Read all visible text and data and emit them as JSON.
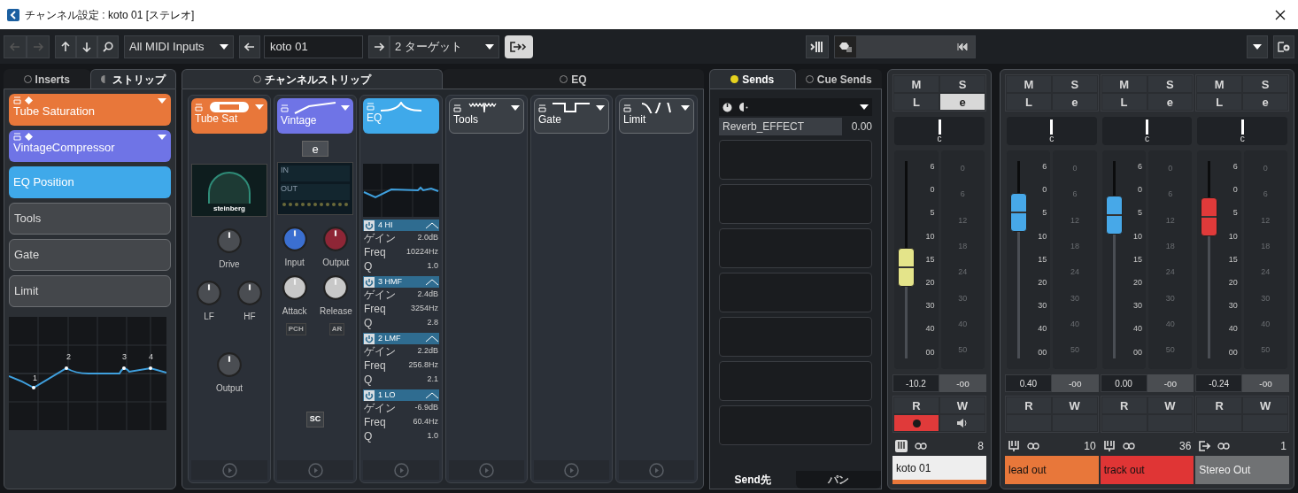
{
  "window": {
    "title": "チャンネル設定 : koto 01 [ステレオ]"
  },
  "toolbar": {
    "midi_input": "All MIDI Inputs",
    "channel_name": "koto 01",
    "target": "2 ターゲット"
  },
  "strip_editor": {
    "tabs": [
      {
        "label": "Inserts",
        "selected": false
      },
      {
        "label": "ストリップ",
        "selected": true
      }
    ],
    "slots": [
      {
        "kind": "plugin",
        "name": "Tube Saturation",
        "color": "#e8773a"
      },
      {
        "kind": "plugin",
        "name": "VintageCompressor",
        "color": "#6f74e6"
      },
      {
        "kind": "marker",
        "name": "EQ Position",
        "color": "#3fa9ea"
      },
      {
        "kind": "module",
        "name": "Tools"
      },
      {
        "kind": "module",
        "name": "Gate"
      },
      {
        "kind": "module",
        "name": "Limit"
      }
    ],
    "eq_points": [
      "1",
      "2",
      "3",
      "4"
    ]
  },
  "channel_strip": {
    "tabs": [
      {
        "label": "チャンネルストリップ",
        "selected": true
      },
      {
        "label": "EQ",
        "selected": false
      }
    ],
    "modules": [
      {
        "kind": "tube",
        "name": "Tube Sat",
        "color": "#e8773a",
        "display": "steinberg",
        "knobs": [
          {
            "label": "Drive",
            "color": "#4a4d52"
          },
          {
            "label": "LF",
            "color": "#4a4d52"
          },
          {
            "label": "HF",
            "color": "#4a4d52"
          },
          {
            "label": "Output",
            "color": "#4a4d52"
          }
        ]
      },
      {
        "kind": "compressor",
        "name": "Vintage",
        "color": "#6f74e6",
        "button": "e",
        "display": [
          "IN",
          "OUT"
        ],
        "knobs": [
          {
            "label": "Input",
            "color": "#3b6fd0"
          },
          {
            "label": "Output",
            "color": "#8e2636"
          },
          {
            "label": "Attack",
            "color": "#c8c8c8"
          },
          {
            "label": "Release",
            "color": "#c8c8c8"
          }
        ],
        "switches": [
          {
            "label": "PCH",
            "on": false
          },
          {
            "label": "AR",
            "on": false
          }
        ],
        "sidechain": "SC"
      },
      {
        "kind": "eq",
        "name": "EQ",
        "color": "#3fa9ea",
        "bands": [
          {
            "name": "4 HI",
            "on": true,
            "params": [
              {
                "label": "ゲイン",
                "value": "2.0dB"
              },
              {
                "label": "Freq",
                "value": "10224Hz"
              },
              {
                "label": "Q",
                "value": "1.0"
              }
            ]
          },
          {
            "name": "3 HMF",
            "on": true,
            "params": [
              {
                "label": "ゲイン",
                "value": "2.4dB"
              },
              {
                "label": "Freq",
                "value": "3254Hz"
              },
              {
                "label": "Q",
                "value": "2.8"
              }
            ]
          },
          {
            "name": "2 LMF",
            "on": true,
            "params": [
              {
                "label": "ゲイン",
                "value": "2.2dB"
              },
              {
                "label": "Freq",
                "value": "256.8Hz"
              },
              {
                "label": "Q",
                "value": "2.1"
              }
            ]
          },
          {
            "name": "1 LO",
            "on": true,
            "params": [
              {
                "label": "ゲイン",
                "value": "-6.9dB"
              },
              {
                "label": "Freq",
                "value": "60.4Hz"
              },
              {
                "label": "Q",
                "value": "1.0"
              }
            ]
          }
        ]
      },
      {
        "kind": "tools",
        "name": "Tools"
      },
      {
        "kind": "gate",
        "name": "Gate"
      },
      {
        "kind": "limit",
        "name": "Limit"
      }
    ]
  },
  "sends": {
    "tabs": [
      {
        "label": "Sends",
        "selected": true
      },
      {
        "label": "Cue Sends",
        "selected": false
      }
    ],
    "slots": [
      {
        "name": "Reverb_EFFECT",
        "value": "0.00"
      }
    ],
    "bottom_tabs": [
      {
        "label": "Send先",
        "selected": true
      },
      {
        "label": "パン",
        "selected": false
      }
    ]
  },
  "channels": [
    {
      "kind": "track",
      "name": "koto 01",
      "color": "#e8773a",
      "number": "8",
      "buttons": [
        {
          "label": "M",
          "on": false
        },
        {
          "label": "S",
          "on": false
        },
        {
          "label": "L",
          "on": false
        },
        {
          "label": "e",
          "on": true
        }
      ],
      "pan": "c",
      "fader_scale": [
        "6",
        "0",
        "5",
        "10",
        "15",
        "20",
        "30",
        "40",
        "00"
      ],
      "meter_scale": [
        "0",
        "6",
        "12",
        "18",
        "24",
        "30",
        "40",
        "50"
      ],
      "level": 0.45,
      "volume": "-10.2",
      "peak": "-oo",
      "automation": [
        {
          "label": "R",
          "on": false
        },
        {
          "label": "W",
          "on": false
        }
      ],
      "record": true
    },
    {
      "kind": "group",
      "name": "lead out",
      "color": "#e8773a",
      "number": "10",
      "buttons": [
        {
          "label": "M",
          "on": false
        },
        {
          "label": "S",
          "on": false
        },
        {
          "label": "L",
          "on": false
        },
        {
          "label": "e",
          "on": false
        }
      ],
      "pan": "c",
      "fader_scale": [
        "6",
        "0",
        "5",
        "10",
        "15",
        "20",
        "30",
        "40",
        "00"
      ],
      "meter_scale": [
        "0",
        "6",
        "12",
        "18",
        "24",
        "30",
        "40",
        "50"
      ],
      "level": 0.8,
      "volume": "0.40",
      "peak": "-oo",
      "automation": [
        {
          "label": "R",
          "on": false
        },
        {
          "label": "W",
          "on": false
        }
      ]
    },
    {
      "kind": "group",
      "name": "track out",
      "color": "#e03535",
      "number": "36",
      "buttons": [
        {
          "label": "M",
          "on": false
        },
        {
          "label": "S",
          "on": false
        },
        {
          "label": "L",
          "on": false
        },
        {
          "label": "e",
          "on": false
        }
      ],
      "pan": "c",
      "fader_scale": [
        "6",
        "0",
        "5",
        "10",
        "15",
        "20",
        "30",
        "40",
        "00"
      ],
      "meter_scale": [
        "0",
        "6",
        "12",
        "18",
        "24",
        "30",
        "40",
        "50"
      ],
      "level": 0.78,
      "volume": "0.00",
      "peak": "-oo",
      "automation": [
        {
          "label": "R",
          "on": false
        },
        {
          "label": "W",
          "on": false
        }
      ]
    },
    {
      "kind": "output",
      "name": "Stereo Out",
      "color": "#707274",
      "number": "1",
      "buttons": [
        {
          "label": "M",
          "on": false
        },
        {
          "label": "S",
          "on": false
        },
        {
          "label": "L",
          "on": false
        },
        {
          "label": "e",
          "on": false
        }
      ],
      "pan": "c",
      "fader_scale": [
        "6",
        "0",
        "5",
        "10",
        "15",
        "20",
        "30",
        "40",
        "00"
      ],
      "meter_scale": [
        "0",
        "6",
        "12",
        "18",
        "24",
        "30",
        "40",
        "50"
      ],
      "level": 0.77,
      "volume": "-0.24",
      "peak": "-oo",
      "automation": [
        {
          "label": "R",
          "on": false
        },
        {
          "label": "W",
          "on": false
        }
      ]
    }
  ]
}
